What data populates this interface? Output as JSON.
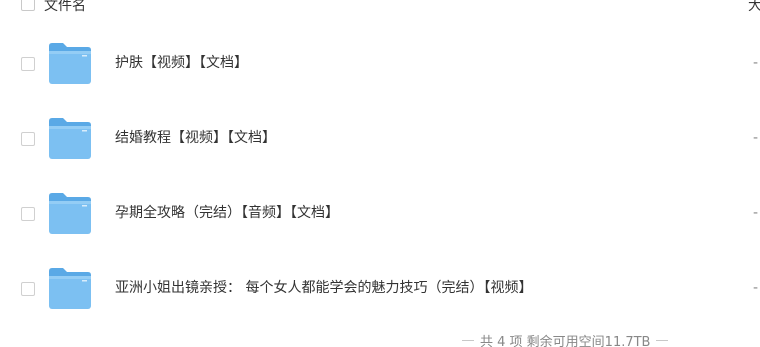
{
  "header": {
    "name_col": "文件名",
    "size_col": "大"
  },
  "rows": [
    {
      "name": "护肤【视频】【文档】",
      "size": "-",
      "icon": "folder-icon"
    },
    {
      "name": "结婚教程【视频】【文档】",
      "size": "-",
      "icon": "folder-icon"
    },
    {
      "name": "孕期全攻略（完结）【音频】【文档】",
      "size": "-",
      "icon": "folder-icon"
    },
    {
      "name": "亚洲小姐出镜亲授： 每个女人都能学会的魅力技巧（完结）【视频】",
      "size": "-",
      "icon": "folder-icon"
    }
  ],
  "footer": {
    "summary": "共 4 项 剩余可用空间11.7TB"
  },
  "colors": {
    "folder_body": "#7cc0f2",
    "folder_tab": "#5aa9e6"
  }
}
